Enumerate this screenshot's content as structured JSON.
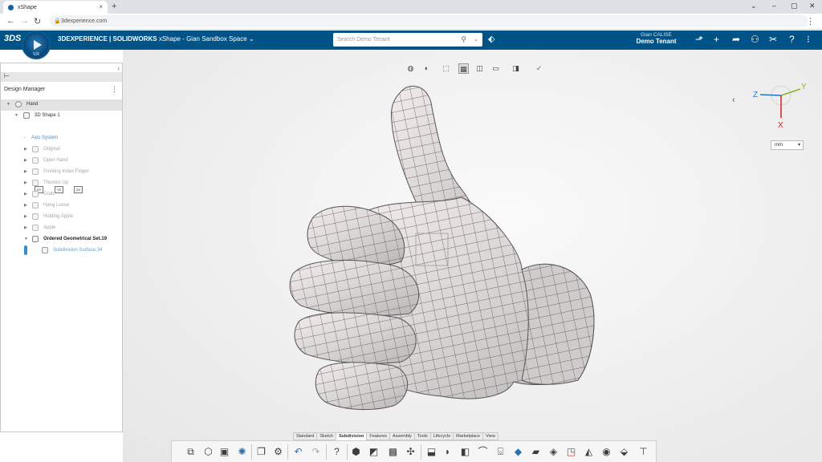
{
  "browser": {
    "tab_title": "xShape",
    "tab_close": "×",
    "new_tab": "+",
    "url": "3dexperience.com",
    "window_controls": [
      "⌄",
      "–",
      "▢",
      "✕"
    ]
  },
  "appbar": {
    "brand": "3DEXPERIENCE | SOLIDWORKS",
    "app_name": "xShape - Gian Sandbox Space",
    "compass_label": "V,R",
    "search_placeholder": "Search Demo Tenant",
    "user_name": "Gian CALISE",
    "tenant": "Demo Tenant",
    "icons": [
      "tag-icon",
      "share-icon",
      "add-icon",
      "forward-icon",
      "network-icon",
      "tools-icon",
      "help-icon",
      "more-icon"
    ]
  },
  "left_panel": {
    "header": "Design Manager",
    "tree": [
      {
        "label": "Hand",
        "style": "sel"
      },
      {
        "label": "3D Shape 1",
        "style": "normal"
      },
      {
        "label": "Axis System",
        "style": "blue"
      },
      {
        "label": "Original",
        "style": "dim"
      },
      {
        "label": "Open Hand",
        "style": "dim"
      },
      {
        "label": "Pointing Index Finger",
        "style": "dim"
      },
      {
        "label": "Thumbs Up",
        "style": "dim"
      },
      {
        "label": "Grab",
        "style": "dim"
      },
      {
        "label": "Hang Loose",
        "style": "dim"
      },
      {
        "label": "Holding Apple",
        "style": "dim"
      },
      {
        "label": "Apple",
        "style": "dim"
      },
      {
        "label": "Ordered Geometrical Set.19",
        "style": "bold"
      },
      {
        "label": "Subdivision Surface.34",
        "style": "sub"
      }
    ],
    "ref_planes": [
      "XY",
      "YZ",
      "ZX"
    ]
  },
  "viewport": {
    "unit": "mm",
    "axes": [
      "Z",
      "Y",
      "X"
    ],
    "axis_colors": {
      "x": "#d42020",
      "y": "#86b81c",
      "z": "#2673c4"
    }
  },
  "bottom_tabs": [
    "Standard",
    "Sketch",
    "Subdivision",
    "Features",
    "Assembly",
    "Tools",
    "Lifecycle",
    "Marketplace",
    "View"
  ],
  "active_bottom_tab": "Subdivision"
}
